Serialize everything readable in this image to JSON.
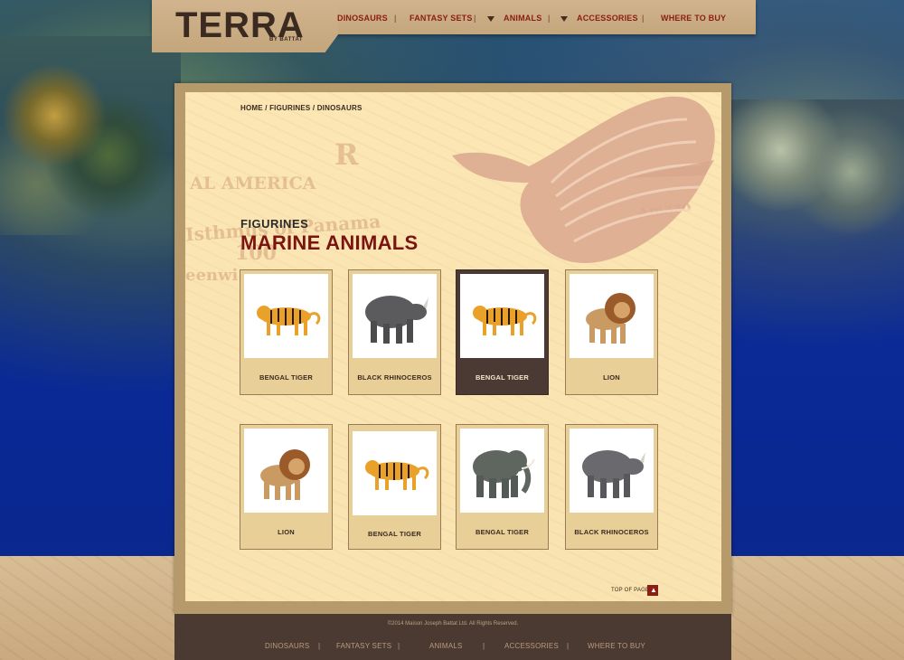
{
  "brand": {
    "logo_text": "TERRA",
    "logo_sub": "BY BATTAT"
  },
  "nav": {
    "items": [
      "DINOSAURS",
      "FANTASY SETS",
      "ANIMALS",
      "ACCESSORIES",
      "WHERE TO BUY"
    ],
    "separator": "|"
  },
  "breadcrumb": "HOME / FIGURINES / DINOSAURS",
  "section": {
    "category": "FIGURINES",
    "title": "MARINE ANIMALS"
  },
  "map_words": {
    "america": "AL AMERICA",
    "isthmus": "Isthmus of Panama",
    "amazon": "Amazo",
    "greenwich": "eenwi",
    "numbers": "100",
    "r": "R"
  },
  "products": [
    {
      "name": "BENGAL TIGER",
      "image": "tiger",
      "active": false
    },
    {
      "name": "BLACK RHINOCEROS",
      "image": "rhino",
      "active": false
    },
    {
      "name": "BENGAL TIGER",
      "image": "tiger",
      "active": true
    },
    {
      "name": "LION",
      "image": "lion",
      "active": false
    },
    {
      "name": "LION",
      "image": "lion",
      "active": false
    },
    {
      "name": "BENGAL TIGER",
      "image": "tiger",
      "active": false
    },
    {
      "name": "BENGAL TIGER",
      "image": "elephant",
      "active": false
    },
    {
      "name": "BLACK RHINOCEROS",
      "image": "rhino",
      "active": false
    }
  ],
  "top_of_page": {
    "label": "TOP OF PAGE",
    "icon": "up-arrow-icon"
  },
  "footer": {
    "copyright": "©2014 Maison Joseph Battat Ltd. All Rights Reserved.",
    "nav": [
      "DINOSAURS",
      "FANTASY SETS",
      "ANIMALS",
      "ACCESSORIES",
      "WHERE TO BUY"
    ],
    "separator": "|"
  },
  "colors": {
    "accent": "#7a1410",
    "nav_red": "#8b1d12",
    "paper": "#fbe6b4",
    "card": "#e8cf98",
    "footer": "#4b3a31"
  }
}
